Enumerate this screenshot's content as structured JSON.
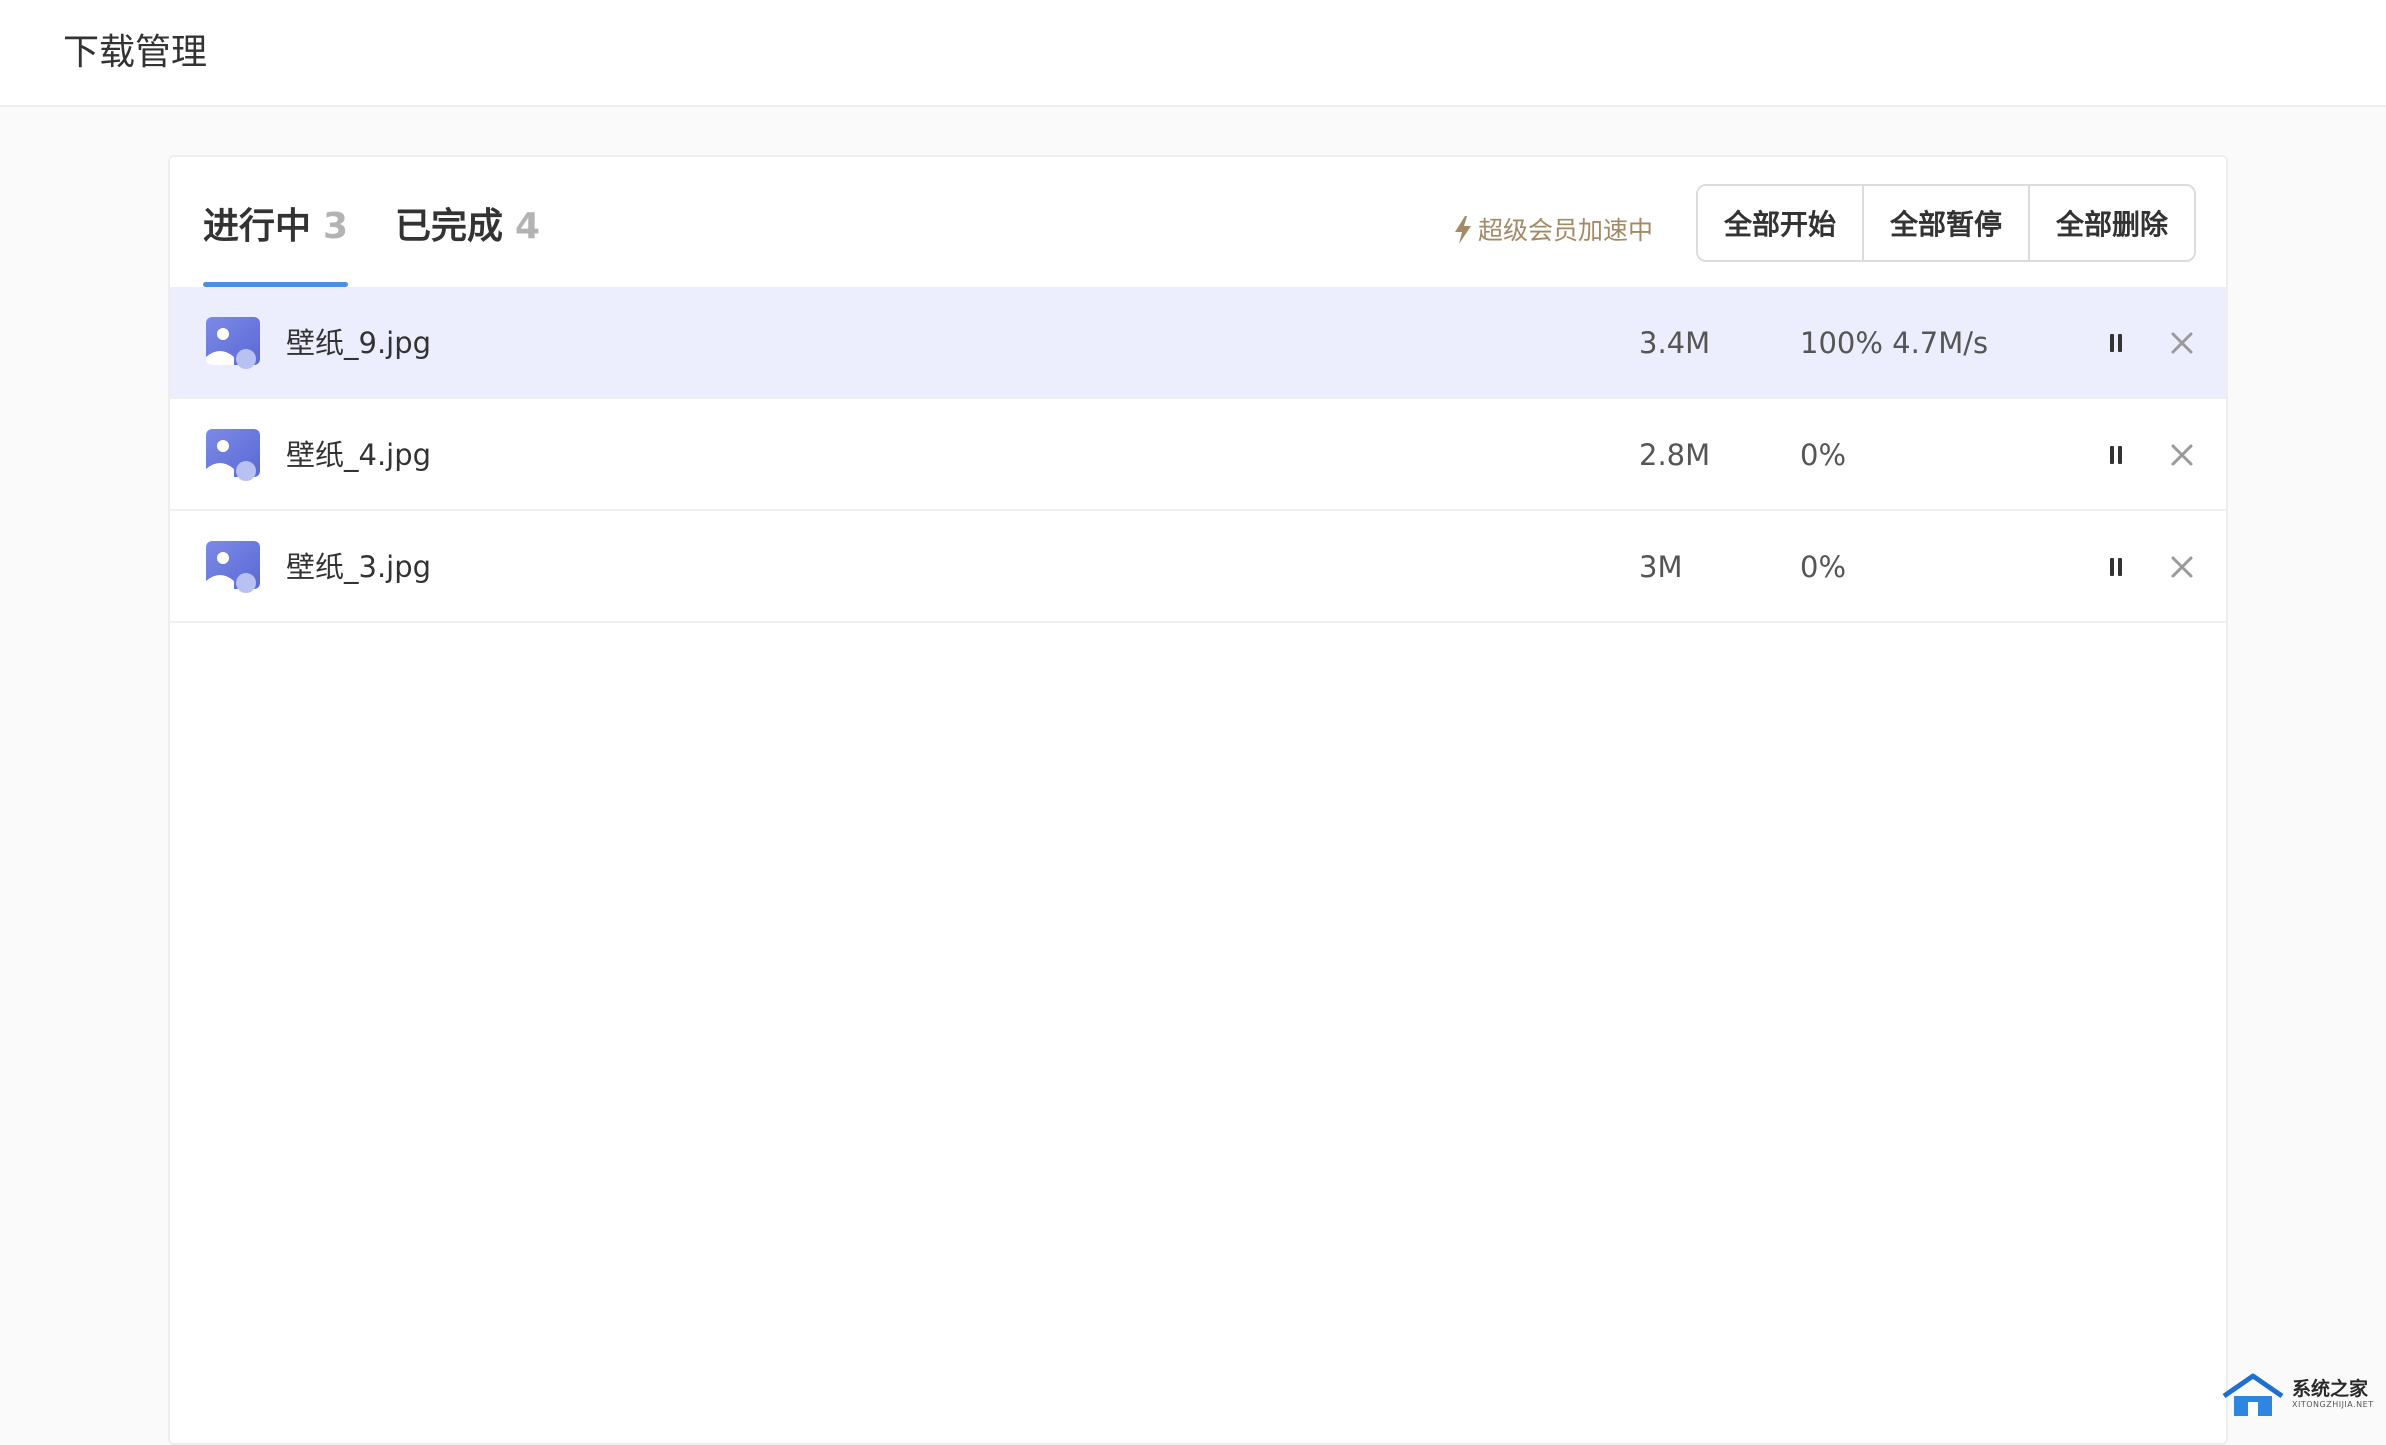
{
  "header": {
    "title": "下载管理"
  },
  "tabs": [
    {
      "label": "进行中",
      "count": "3",
      "active": true
    },
    {
      "label": "已完成",
      "count": "4",
      "active": false
    }
  ],
  "vip": {
    "label": "超级会员加速中",
    "icon": "lightning-icon",
    "color": "#a38a66"
  },
  "actions": {
    "start_all": "全部开始",
    "pause_all": "全部暂停",
    "delete_all": "全部删除"
  },
  "downloads": [
    {
      "name": "壁纸_9.jpg",
      "size": "3.4M",
      "progress": "100% 4.7M/s",
      "selected": true
    },
    {
      "name": "壁纸_4.jpg",
      "size": "2.8M",
      "progress": "0%",
      "selected": false
    },
    {
      "name": "壁纸_3.jpg",
      "size": "3M",
      "progress": "0%",
      "selected": false
    }
  ],
  "icons": {
    "file": "image-file-icon",
    "pause": "pause-icon",
    "close": "close-icon"
  },
  "colors": {
    "accent": "#4b8fe5",
    "selected_row": "#eceefd",
    "icon_primary": "#6f7fe0",
    "count_muted": "#b3b3b3"
  },
  "watermark": {
    "text": "系统之家",
    "sub": "XITONGZHIJIA.NET"
  }
}
